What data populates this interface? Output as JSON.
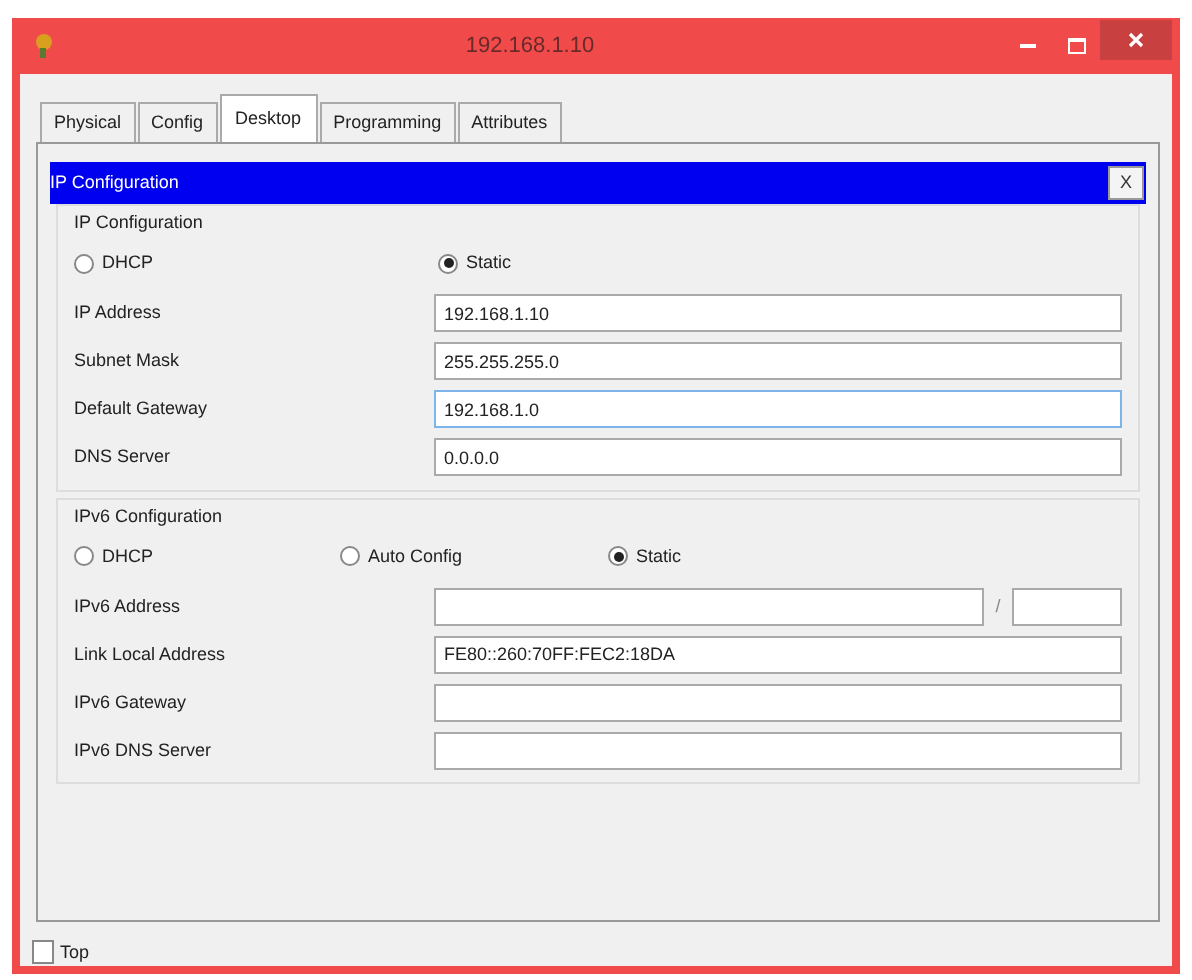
{
  "window": {
    "title": "192.168.1.10"
  },
  "tabs": [
    {
      "label": "Physical",
      "selected": false
    },
    {
      "label": "Config",
      "selected": false
    },
    {
      "label": "Desktop",
      "selected": true
    },
    {
      "label": "Programming",
      "selected": false
    },
    {
      "label": "Attributes",
      "selected": false
    }
  ],
  "panel": {
    "title": "IP Configuration",
    "close": "X"
  },
  "ipv4": {
    "legend": "IP Configuration",
    "modes": [
      {
        "label": "DHCP",
        "selected": false
      },
      {
        "label": "Static",
        "selected": true
      }
    ],
    "fields": [
      {
        "label": "IP Address",
        "value": "192.168.1.10",
        "focused": false
      },
      {
        "label": "Subnet Mask",
        "value": "255.255.255.0",
        "focused": false
      },
      {
        "label": "Default Gateway",
        "value": "192.168.1.0",
        "focused": true
      },
      {
        "label": "DNS Server",
        "value": "0.0.0.0",
        "focused": false
      }
    ]
  },
  "ipv6": {
    "legend": "IPv6 Configuration",
    "modes": [
      {
        "label": "DHCP",
        "selected": false
      },
      {
        "label": "Auto Config",
        "selected": false
      },
      {
        "label": "Static",
        "selected": true
      }
    ],
    "fields": [
      {
        "label": "IPv6 Address",
        "kind": "prefix",
        "separator": "/"
      },
      {
        "label": "Link Local Address",
        "kind": "plain",
        "value": "FE80::260:70FF:FEC2:18DA"
      },
      {
        "label": "IPv6 Gateway",
        "kind": "plain"
      },
      {
        "label": "IPv6 DNS Server",
        "kind": "plain"
      }
    ]
  },
  "top_checkbox": {
    "label": "Top",
    "checked": false
  }
}
